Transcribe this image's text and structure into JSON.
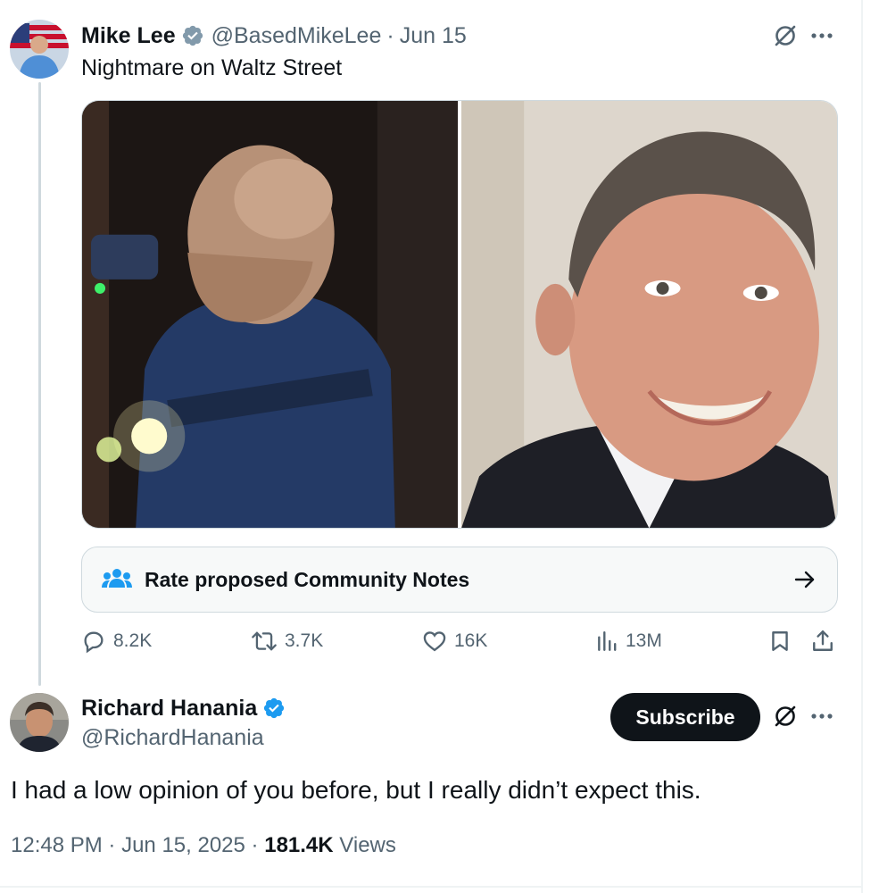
{
  "tweet1": {
    "author_name": "Mike Lee",
    "handle": "@BasedMikeLee",
    "separator": "·",
    "date": "Jun 15",
    "text": "Nightmare on Waltz Street",
    "media": [
      "masked-figure-photo",
      "smiling-man-portrait"
    ],
    "community_notes_label": "Rate proposed Community Notes",
    "stats": {
      "replies": "8.2K",
      "reposts": "3.7K",
      "likes": "16K",
      "views": "13M"
    }
  },
  "tweet2": {
    "author_name": "Richard Hanania",
    "handle": "@RichardHanania",
    "subscribe_label": "Subscribe",
    "text": "I had a low opinion of you before, but I really didn’t expect this.",
    "time": "12:48 PM",
    "date": "Jun 15, 2025",
    "separator": "·",
    "views_count": "181.4K",
    "views_label": "Views"
  },
  "colors": {
    "text": "#0f1419",
    "secondary": "#536471",
    "verified": "#1d9bf0",
    "border": "#cfd9de",
    "button_bg": "#0f1419"
  },
  "icons": [
    "verified-badge-icon",
    "grok-icon",
    "more-icon",
    "community-notes-icon",
    "arrow-right-icon",
    "reply-icon",
    "retweet-icon",
    "like-icon",
    "views-icon",
    "bookmark-icon",
    "share-icon"
  ]
}
